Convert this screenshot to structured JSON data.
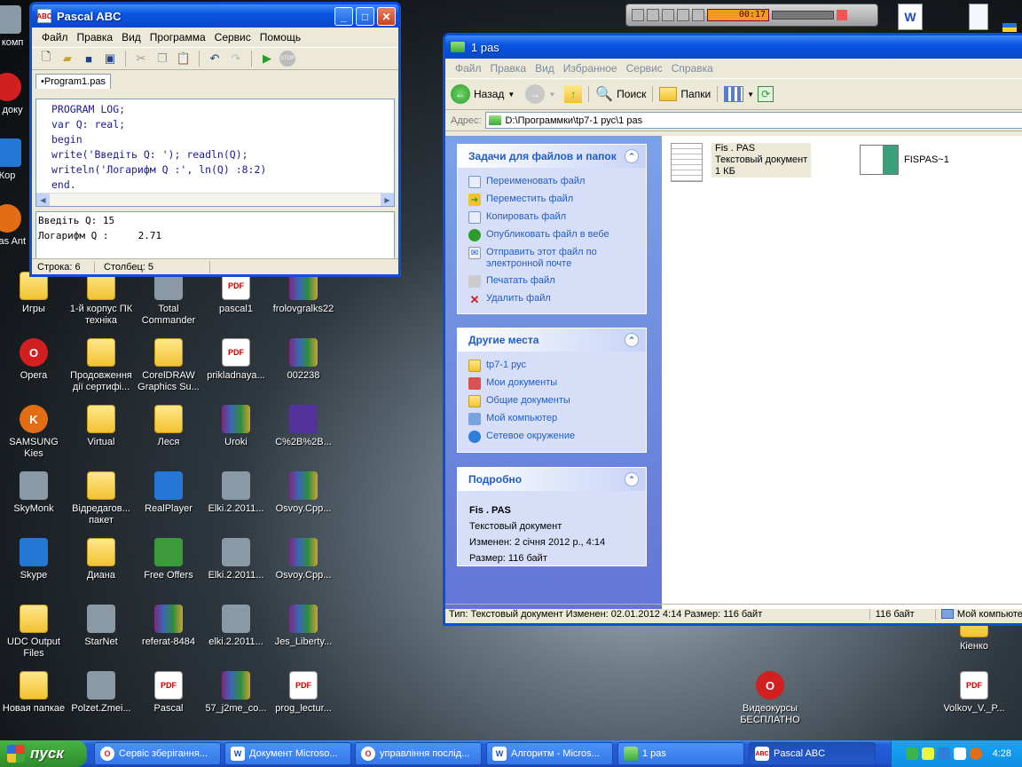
{
  "desktop": {
    "icons": [
      {
        "label": "Игры",
        "kind": "folder"
      },
      {
        "label": "1-й корпус ПК техніка",
        "kind": "folder"
      },
      {
        "label": "Total Commander",
        "kind": "app-gray"
      },
      {
        "label": "pascal1",
        "kind": "pdf"
      },
      {
        "label": "frolovgralks22",
        "kind": "rar"
      },
      {
        "label": "Opera",
        "kind": "opera"
      },
      {
        "label": "Продовження дії сертифі...",
        "kind": "folder"
      },
      {
        "label": "CorelDRAW Graphics Su...",
        "kind": "folder"
      },
      {
        "label": "prikladnaya...",
        "kind": "pdf"
      },
      {
        "label": "002238",
        "kind": "rar"
      },
      {
        "label": "SAMSUNG Kies",
        "kind": "kies"
      },
      {
        "label": "Virtual",
        "kind": "folder"
      },
      {
        "label": "Леся",
        "kind": "folder"
      },
      {
        "label": "Uroki",
        "kind": "rar"
      },
      {
        "label": "C%2B%2B...",
        "kind": "violet"
      },
      {
        "label": "SkyMonk",
        "kind": "app-gray"
      },
      {
        "label": "Відредагов... пакет",
        "kind": "folder"
      },
      {
        "label": "RealPlayer",
        "kind": "app-blue"
      },
      {
        "label": "Elki.2.2011...",
        "kind": "app-gray"
      },
      {
        "label": "Osvoy.Cpp...",
        "kind": "rar"
      },
      {
        "label": "Skype",
        "kind": "app-blue"
      },
      {
        "label": "Диана",
        "kind": "folder"
      },
      {
        "label": "Free Offers",
        "kind": "green"
      },
      {
        "label": "Elki.2.2011...",
        "kind": "app-gray"
      },
      {
        "label": "Osvoy.Cpp...",
        "kind": "rar"
      },
      {
        "label": "UDC Output Files",
        "kind": "folder"
      },
      {
        "label": "StarNet",
        "kind": "app-gray"
      },
      {
        "label": "referat-8484",
        "kind": "rar"
      },
      {
        "label": "elki.2.2011...",
        "kind": "app-gray"
      },
      {
        "label": "Jes_Liberty...",
        "kind": "rar"
      },
      {
        "label": "Новая папкае",
        "kind": "folder"
      },
      {
        "label": "Polzet.Zmei...",
        "kind": "app-gray"
      },
      {
        "label": "Pascal",
        "kind": "pdf"
      },
      {
        "label": "57_j2me_co...",
        "kind": "rar"
      },
      {
        "label": "prog_lectur...",
        "kind": "pdf"
      },
      {
        "label": "Видеокурсы БЕСПЛАТНО",
        "kind": "opera"
      },
      {
        "label": "Volkov_V._P...",
        "kind": "pdf"
      },
      {
        "label": "Кіенко",
        "kind": "folder"
      }
    ],
    "partial_left": [
      "М комп",
      "М доку",
      "Кор",
      "avas Ant"
    ]
  },
  "pascal": {
    "title": "Pascal ABC",
    "menu": [
      "Файл",
      "Правка",
      "Вид",
      "Программа",
      "Сервис",
      "Помощь"
    ],
    "tab": "•Program1.pas",
    "code": [
      "PROGRAM LOG;",
      "var Q: real;",
      "begin",
      "write('Введіть Q: '); readln(Q);",
      "writeln('Логарифм Q :', ln(Q) :8:2)",
      "end."
    ],
    "output": [
      "Введіть Q: 15",
      "Логарифм Q :     2.71"
    ],
    "status": {
      "row": "Строка: 6",
      "col": "Столбец: 5"
    }
  },
  "explorer": {
    "title": "1 pas",
    "menu": [
      "Файл",
      "Правка",
      "Вид",
      "Избранное",
      "Сервис",
      "Справка"
    ],
    "toolbar": {
      "back": "Назад",
      "search": "Поиск",
      "folders": "Папки"
    },
    "address_label": "Адрес:",
    "address": "D:\\Программки\\tp7-1 рус\\1 pas",
    "tasks": {
      "title": "Задачи для файлов и папок",
      "items": [
        "Переименовать файл",
        "Переместить файл",
        "Копировать файл",
        "Опубликовать файл в вебе",
        "Отправить этот файл по электронной почте",
        "Печатать файл",
        "Удалить файл"
      ]
    },
    "places": {
      "title": "Другие места",
      "items": [
        "tp7-1 рус",
        "Мои документы",
        "Общие документы",
        "Мой компьютер",
        "Сетевое окружение"
      ]
    },
    "details": {
      "title": "Подробно",
      "name": "Fis . PAS",
      "type": "Текстовый документ",
      "modified": "Изменен: 2 січня 2012 р., 4:14",
      "size": "Размер: 116 байт"
    },
    "files": [
      {
        "name": "Fis . PAS",
        "type": "Текстовый документ",
        "size": "1 КБ"
      },
      {
        "name": "FISPAS~1"
      }
    ],
    "status": {
      "info": "Тип: Текстовый документ Изменен: 02.01.2012 4:14 Размер: 116 байт",
      "size": "116 байт",
      "location": "Мой компьютер"
    }
  },
  "taskbar": {
    "start": "пуск",
    "tasks": [
      {
        "label": "Сервіс зберігання...",
        "icon": "O"
      },
      {
        "label": "Документ Microso...",
        "icon": "W"
      },
      {
        "label": "управління послід...",
        "icon": "O"
      },
      {
        "label": "Алгоритм - Micros...",
        "icon": "W"
      },
      {
        "label": "1 pas",
        "icon": "folder"
      },
      {
        "label": "Pascal ABC",
        "icon": "abc"
      }
    ],
    "clock": "4:28"
  },
  "media_bar": {
    "time": "00:17"
  }
}
